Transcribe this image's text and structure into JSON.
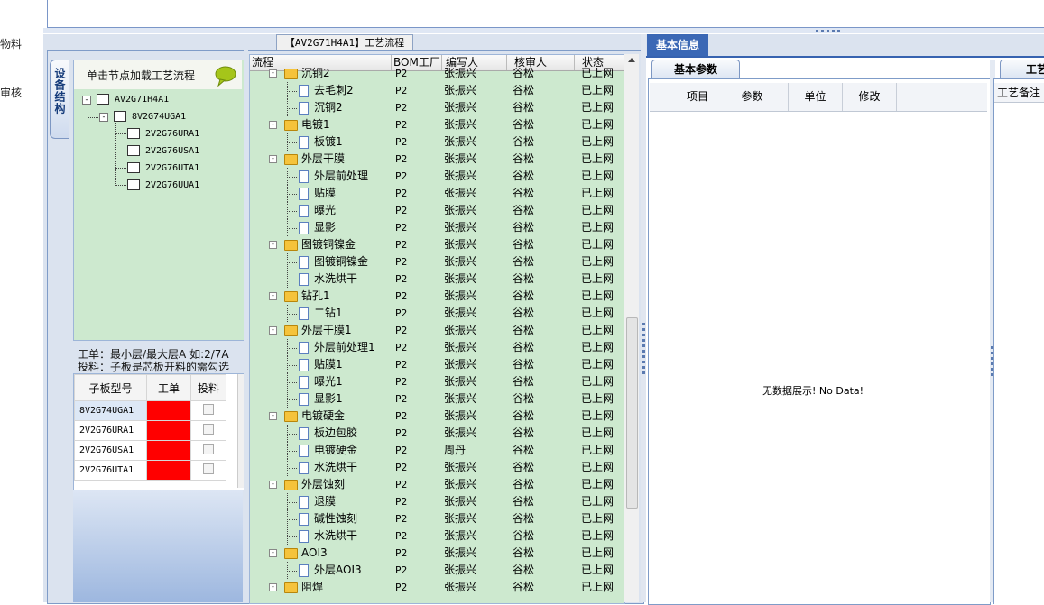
{
  "left_strip": {
    "labels": [
      "物料",
      "审核"
    ]
  },
  "flow_tab": {
    "label": "【AV2G71H4A1】工艺流程"
  },
  "device_panel": {
    "vertical_tab": "设备结构",
    "header": "单击节点加载工艺流程",
    "tree": [
      {
        "label": "AV2G71H4A1",
        "level": 0
      },
      {
        "label": "8V2G74UGA1",
        "level": 1
      },
      {
        "label": "2V2G76URA1",
        "level": 2
      },
      {
        "label": "2V2G76USA1",
        "level": 2
      },
      {
        "label": "2V2G76UTA1",
        "level": 2
      },
      {
        "label": "2V2G76UUA1",
        "level": 2
      }
    ],
    "info_line1": "工单：最小层/最大层A 如:2/7A",
    "info_line2": "投料：子板是芯板开料的需勾选"
  },
  "subboard_grid": {
    "headers": [
      "子板型号",
      "工单",
      "投料"
    ],
    "rows": [
      {
        "model": "8V2G74UGA1"
      },
      {
        "model": "2V2G76URA1"
      },
      {
        "model": "2V2G76USA1"
      },
      {
        "model": "2V2G76UTA1"
      }
    ]
  },
  "flow_table": {
    "headers": [
      "流程",
      "BOM工厂",
      "编写人",
      "核审人",
      "状态"
    ],
    "rows": [
      {
        "name": "沉铜2",
        "type": "folder",
        "bom": "P2",
        "writer": "张振兴",
        "reviewer": "谷松",
        "status": "已上网"
      },
      {
        "name": "去毛刺2",
        "type": "doc",
        "bom": "P2",
        "writer": "张振兴",
        "reviewer": "谷松",
        "status": "已上网"
      },
      {
        "name": "沉铜2",
        "type": "doc",
        "bom": "P2",
        "writer": "张振兴",
        "reviewer": "谷松",
        "status": "已上网"
      },
      {
        "name": "电镀1",
        "type": "folder",
        "bom": "P2",
        "writer": "张振兴",
        "reviewer": "谷松",
        "status": "已上网"
      },
      {
        "name": "板镀1",
        "type": "doc",
        "bom": "P2",
        "writer": "张振兴",
        "reviewer": "谷松",
        "status": "已上网"
      },
      {
        "name": "外层干膜",
        "type": "folder",
        "bom": "P2",
        "writer": "张振兴",
        "reviewer": "谷松",
        "status": "已上网"
      },
      {
        "name": "外层前处理",
        "type": "doc",
        "bom": "P2",
        "writer": "张振兴",
        "reviewer": "谷松",
        "status": "已上网"
      },
      {
        "name": "贴膜",
        "type": "doc",
        "bom": "P2",
        "writer": "张振兴",
        "reviewer": "谷松",
        "status": "已上网"
      },
      {
        "name": "曝光",
        "type": "doc",
        "bom": "P2",
        "writer": "张振兴",
        "reviewer": "谷松",
        "status": "已上网"
      },
      {
        "name": "显影",
        "type": "doc",
        "bom": "P2",
        "writer": "张振兴",
        "reviewer": "谷松",
        "status": "已上网"
      },
      {
        "name": "图镀铜镍金",
        "type": "folder",
        "bom": "P2",
        "writer": "张振兴",
        "reviewer": "谷松",
        "status": "已上网"
      },
      {
        "name": "图镀铜镍金",
        "type": "doc",
        "bom": "P2",
        "writer": "张振兴",
        "reviewer": "谷松",
        "status": "已上网"
      },
      {
        "name": "水洗烘干",
        "type": "doc",
        "bom": "P2",
        "writer": "张振兴",
        "reviewer": "谷松",
        "status": "已上网"
      },
      {
        "name": "钻孔1",
        "type": "folder",
        "bom": "P2",
        "writer": "张振兴",
        "reviewer": "谷松",
        "status": "已上网"
      },
      {
        "name": "二钻1",
        "type": "doc",
        "bom": "P2",
        "writer": "张振兴",
        "reviewer": "谷松",
        "status": "已上网"
      },
      {
        "name": "外层干膜1",
        "type": "folder",
        "bom": "P2",
        "writer": "张振兴",
        "reviewer": "谷松",
        "status": "已上网"
      },
      {
        "name": "外层前处理1",
        "type": "doc",
        "bom": "P2",
        "writer": "张振兴",
        "reviewer": "谷松",
        "status": "已上网"
      },
      {
        "name": "贴膜1",
        "type": "doc",
        "bom": "P2",
        "writer": "张振兴",
        "reviewer": "谷松",
        "status": "已上网"
      },
      {
        "name": "曝光1",
        "type": "doc",
        "bom": "P2",
        "writer": "张振兴",
        "reviewer": "谷松",
        "status": "已上网"
      },
      {
        "name": "显影1",
        "type": "doc",
        "bom": "P2",
        "writer": "张振兴",
        "reviewer": "谷松",
        "status": "已上网"
      },
      {
        "name": "电镀硬金",
        "type": "folder",
        "bom": "P2",
        "writer": "张振兴",
        "reviewer": "谷松",
        "status": "已上网"
      },
      {
        "name": "板边包胶",
        "type": "doc",
        "bom": "P2",
        "writer": "张振兴",
        "reviewer": "谷松",
        "status": "已上网"
      },
      {
        "name": "电镀硬金",
        "type": "doc",
        "bom": "P2",
        "writer": "周丹",
        "reviewer": "谷松",
        "status": "已上网"
      },
      {
        "name": "水洗烘干",
        "type": "doc",
        "bom": "P2",
        "writer": "张振兴",
        "reviewer": "谷松",
        "status": "已上网"
      },
      {
        "name": "外层蚀刻",
        "type": "folder",
        "bom": "P2",
        "writer": "张振兴",
        "reviewer": "谷松",
        "status": "已上网"
      },
      {
        "name": "退膜",
        "type": "doc",
        "bom": "P2",
        "writer": "张振兴",
        "reviewer": "谷松",
        "status": "已上网"
      },
      {
        "name": "碱性蚀刻",
        "type": "doc",
        "bom": "P2",
        "writer": "张振兴",
        "reviewer": "谷松",
        "status": "已上网"
      },
      {
        "name": "水洗烘干",
        "type": "doc",
        "bom": "P2",
        "writer": "张振兴",
        "reviewer": "谷松",
        "status": "已上网"
      },
      {
        "name": "AOI3",
        "type": "folder",
        "bom": "P2",
        "writer": "张振兴",
        "reviewer": "谷松",
        "status": "已上网"
      },
      {
        "name": "外层AOI3",
        "type": "doc",
        "bom": "P2",
        "writer": "张振兴",
        "reviewer": "谷松",
        "status": "已上网"
      },
      {
        "name": "阻焊",
        "type": "folder",
        "bom": "P2",
        "writer": "张振兴",
        "reviewer": "谷松",
        "status": "已上网"
      }
    ]
  },
  "basic_info": {
    "tab": "基本信息",
    "sub_tab": "基本参数",
    "headers": [
      "项目",
      "参数",
      "单位",
      "修改"
    ],
    "empty_text": "无数据展示! No Data!"
  },
  "process_notes": {
    "tab": "工艺",
    "header": "工艺备注"
  },
  "colors": {
    "tree_bg": "#cde9cf",
    "accent_blue": "#3b68b5",
    "work_order_red": "#ff0000"
  }
}
